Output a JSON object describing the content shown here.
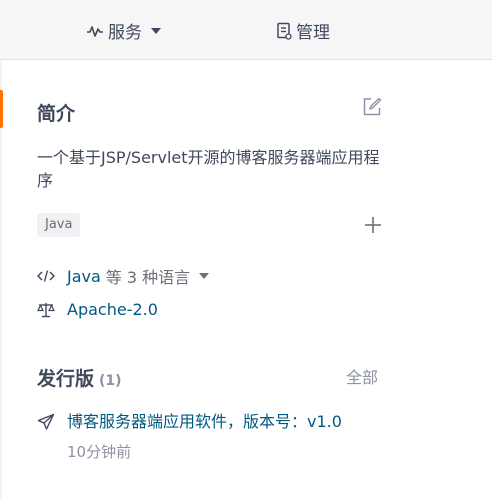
{
  "topbar": {
    "services_label": "服务",
    "manage_label": "管理"
  },
  "intro": {
    "title": "简介",
    "description": "一个基于JSP/Servlet开源的博客服务器端应用程序",
    "tag": "Java"
  },
  "language": {
    "primary": "Java",
    "more": "等 3 种语言"
  },
  "license": {
    "name": "Apache-2.0"
  },
  "releases": {
    "title": "发行版",
    "count": "(1)",
    "all_label": "全部",
    "latest_label": "博客服务器端应用软件，版本号：v1.0",
    "latest_time": "10分钟前"
  },
  "colors": {
    "accent": "#fe7300",
    "link": "#005980",
    "text": "#40485b",
    "muted": "#8c92a4"
  },
  "icons": [
    "pulse-icon",
    "document-icon",
    "edit-icon",
    "plus-icon",
    "code-icon",
    "scale-icon",
    "send-icon"
  ]
}
